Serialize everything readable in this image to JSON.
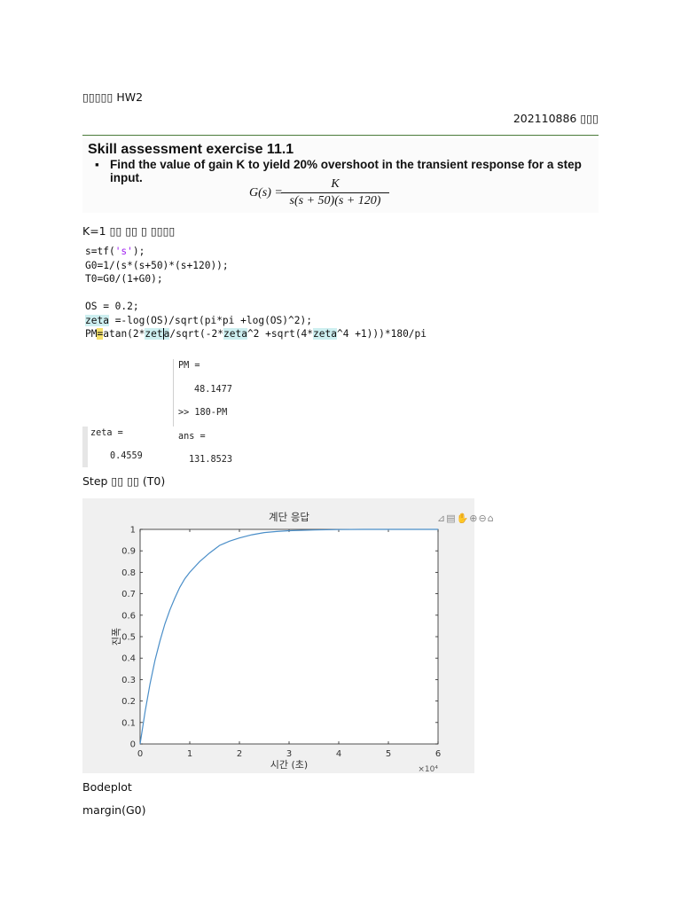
{
  "header": {
    "title": "▯▯▯▯▯ HW2",
    "student_id": "202110886 ▯▯▯"
  },
  "problem": {
    "heading": "Skill assessment exercise 11.1",
    "bullet": "▪",
    "task": "Find the value of gain K to yield 20% overshoot in the transient response for a step input.",
    "formula_lhs": "G(s) =",
    "formula_num": "K",
    "formula_den": "s(s + 50)(s + 120)"
  },
  "k_note": "K=1 ▯▯ ▯▯ ▯ ▯▯▯▯",
  "code": {
    "l1_a": "s=tf(",
    "l1_str": "'s'",
    "l1_b": ");",
    "l2": "G0=1/(s*(s+50)*(s+120));",
    "l3": "T0=G0/(1+G0);",
    "l5": "OS = 0.2;",
    "l6_zeta": "zeta",
    "l6_rest": " =-log(OS)/sqrt(pi*pi +log(OS)^2);",
    "l7_a": "PM",
    "l7_eq": "=",
    "l7_b": "atan(2*",
    "l7_zeta1a": "zet",
    "l7_zeta1b": "a",
    "l7_c": "/sqrt(-2*",
    "l7_zeta2": "zeta",
    "l7_d": "^2 +sqrt(4*",
    "l7_zeta3": "zeta",
    "l7_e": "^4 +1)))*180/pi"
  },
  "console": {
    "zeta_label": "zeta =",
    "zeta_value": "0.4559",
    "pm_label": "PM =",
    "pm_value": "48.1477",
    "command": ">> 180-PM",
    "ans_label": "ans =",
    "ans_value": "131.8523"
  },
  "step_label": "Step ▯▯ ▯▯ (T0)",
  "figure_toolbar": "⊿▤✋⊕⊖⌂",
  "chart_data": {
    "type": "line",
    "title": "계단 응답",
    "xlabel": "시간 (초)",
    "ylabel": "진폭",
    "x_exponent_label": "×10⁴",
    "xlim": [
      0,
      6
    ],
    "ylim": [
      0,
      1
    ],
    "xticks": [
      0,
      1,
      2,
      3,
      4,
      5,
      6
    ],
    "yticks": [
      0,
      0.1,
      0.2,
      0.3,
      0.4,
      0.5,
      0.6,
      0.7,
      0.8,
      0.9,
      1
    ],
    "grid": false,
    "series_color": "#4a8ec8",
    "x": [
      0,
      0.1,
      0.2,
      0.3,
      0.4,
      0.5,
      0.6,
      0.7,
      0.8,
      0.9,
      1.0,
      1.2,
      1.4,
      1.6,
      1.8,
      2.0,
      2.25,
      2.5,
      2.75,
      3.0,
      3.5,
      4.0,
      4.5,
      5.0,
      5.5,
      6.0
    ],
    "y": [
      0,
      0.15,
      0.28,
      0.39,
      0.48,
      0.56,
      0.625,
      0.68,
      0.73,
      0.77,
      0.8,
      0.85,
      0.89,
      0.925,
      0.945,
      0.96,
      0.975,
      0.985,
      0.99,
      0.994,
      0.997,
      0.999,
      1.0,
      1.0,
      1.0,
      1.0
    ]
  },
  "bode_label": "Bodeplot",
  "margin_cmd": "margin(G0)"
}
